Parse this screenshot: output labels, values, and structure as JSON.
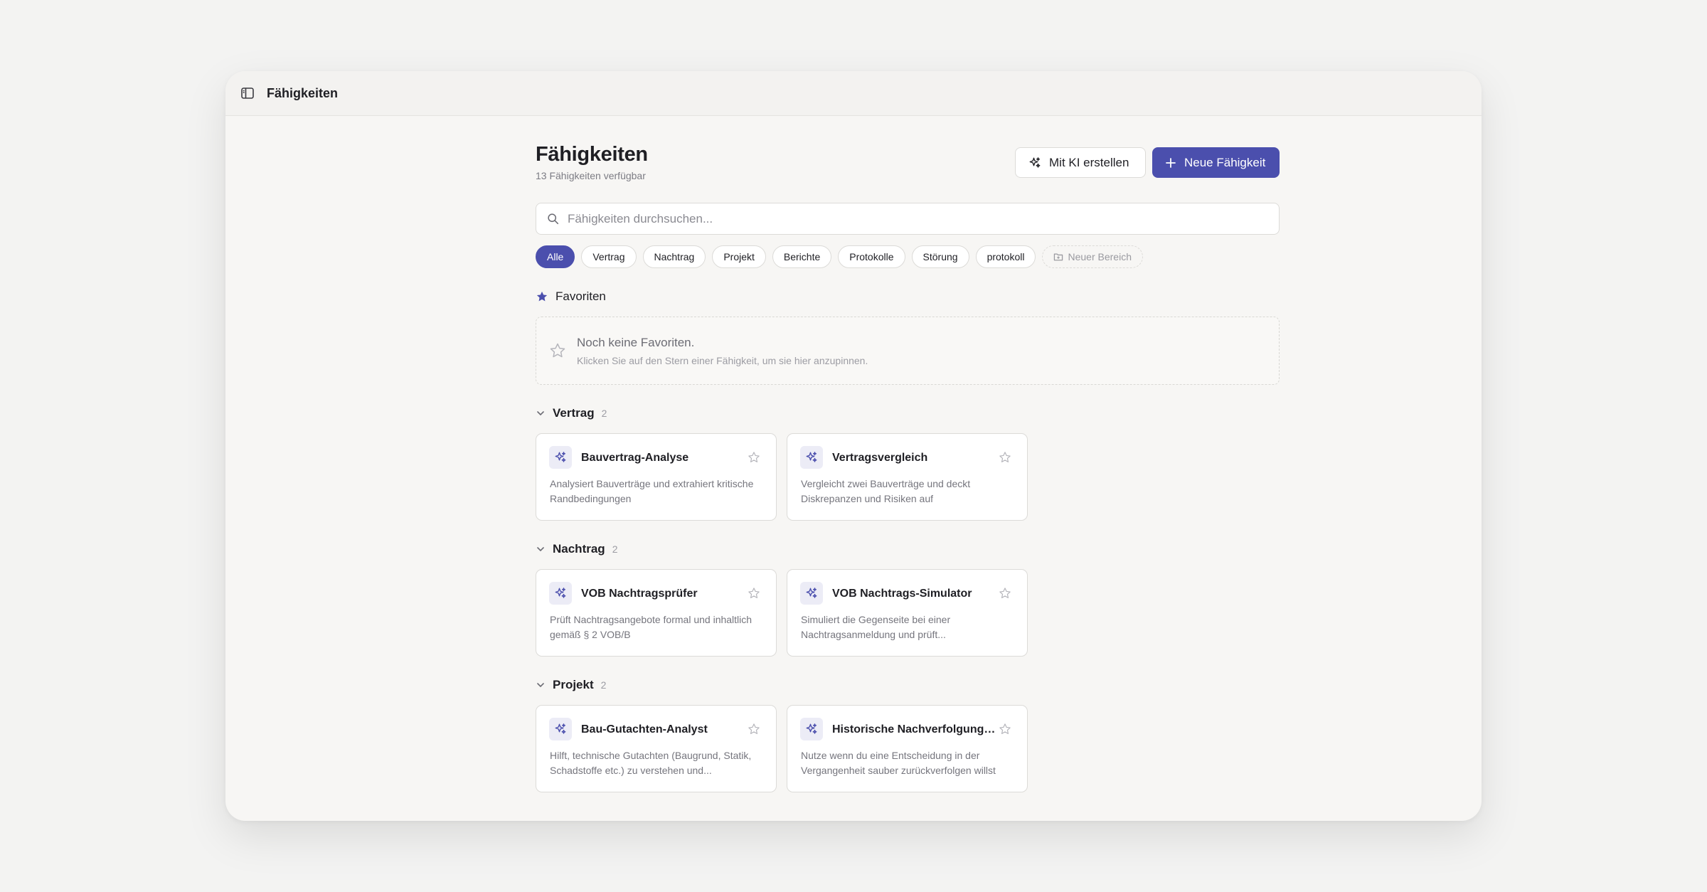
{
  "topbar": {
    "title": "Fähigkeiten",
    "toggle_icon": "sidebar-toggle-icon"
  },
  "header": {
    "title": "Fähigkeiten",
    "subtitle": "13 Fähigkeiten verfügbar",
    "ai_button": "Mit KI erstellen",
    "new_button": "Neue Fähigkeit"
  },
  "search": {
    "placeholder": "Fähigkeiten durchsuchen..."
  },
  "chips": [
    {
      "label": "Alle",
      "active": true
    },
    {
      "label": "Vertrag"
    },
    {
      "label": "Nachtrag"
    },
    {
      "label": "Projekt"
    },
    {
      "label": "Berichte"
    },
    {
      "label": "Protokolle"
    },
    {
      "label": "Störung"
    },
    {
      "label": "protokoll"
    }
  ],
  "new_area_chip": "Neuer Bereich",
  "favorites": {
    "title": "Favoriten",
    "empty_title": "Noch keine Favoriten.",
    "empty_hint": "Klicken Sie auf den Stern einer Fähigkeit, um sie hier anzupinnen."
  },
  "sections": [
    {
      "title": "Vertrag",
      "count": "2",
      "cards": [
        {
          "title": "Bauvertrag-Analyse",
          "desc": "Analysiert Bauverträge und extrahiert kritische Randbedingungen"
        },
        {
          "title": "Vertragsvergleich",
          "desc": "Vergleicht zwei Bauverträge und deckt Diskrepanzen und Risiken auf"
        }
      ]
    },
    {
      "title": "Nachtrag",
      "count": "2",
      "cards": [
        {
          "title": "VOB Nachtragsprüfer",
          "desc": "Prüft Nachtragsangebote formal und inhaltlich gemäß § 2 VOB/B"
        },
        {
          "title": "VOB Nachtrags-Simulator",
          "desc": "Simuliert die Gegenseite bei einer Nachtragsanmeldung und prüft..."
        }
      ]
    },
    {
      "title": "Projekt",
      "count": "2",
      "cards": [
        {
          "title": "Bau-Gutachten-Analyst",
          "desc": "Hilft, technische Gutachten (Baugrund, Statik, Schadstoffe etc.) zu verstehen und..."
        },
        {
          "title": "Historische Nachverfolgung ...",
          "desc": "Nutze wenn du eine Entscheidung in der Vergangenheit sauber zurückverfolgen willst"
        }
      ]
    }
  ],
  "colors": {
    "accent": "#4b4fad",
    "icon_bg": "#ececf6",
    "background": "#f3f3f2"
  }
}
